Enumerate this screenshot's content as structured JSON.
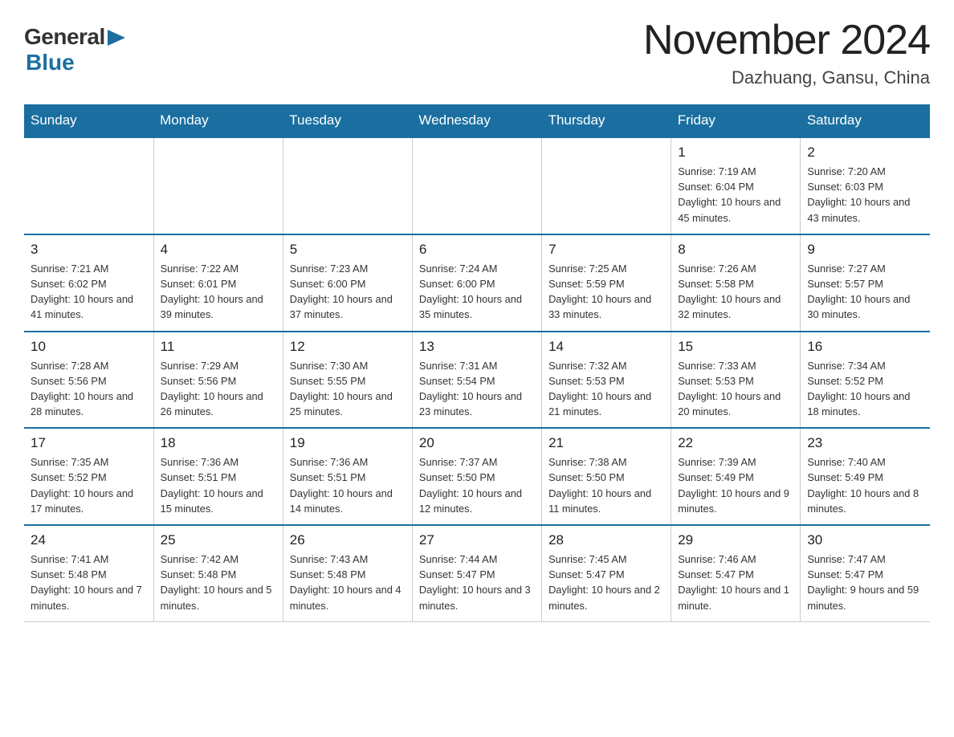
{
  "logo": {
    "general": "General",
    "blue": "Blue",
    "arrow": "▶"
  },
  "title": "November 2024",
  "subtitle": "Dazhuang, Gansu, China",
  "days_of_week": [
    "Sunday",
    "Monday",
    "Tuesday",
    "Wednesday",
    "Thursday",
    "Friday",
    "Saturday"
  ],
  "weeks": [
    [
      {
        "num": "",
        "info": ""
      },
      {
        "num": "",
        "info": ""
      },
      {
        "num": "",
        "info": ""
      },
      {
        "num": "",
        "info": ""
      },
      {
        "num": "",
        "info": ""
      },
      {
        "num": "1",
        "info": "Sunrise: 7:19 AM\nSunset: 6:04 PM\nDaylight: 10 hours and 45 minutes."
      },
      {
        "num": "2",
        "info": "Sunrise: 7:20 AM\nSunset: 6:03 PM\nDaylight: 10 hours and 43 minutes."
      }
    ],
    [
      {
        "num": "3",
        "info": "Sunrise: 7:21 AM\nSunset: 6:02 PM\nDaylight: 10 hours and 41 minutes."
      },
      {
        "num": "4",
        "info": "Sunrise: 7:22 AM\nSunset: 6:01 PM\nDaylight: 10 hours and 39 minutes."
      },
      {
        "num": "5",
        "info": "Sunrise: 7:23 AM\nSunset: 6:00 PM\nDaylight: 10 hours and 37 minutes."
      },
      {
        "num": "6",
        "info": "Sunrise: 7:24 AM\nSunset: 6:00 PM\nDaylight: 10 hours and 35 minutes."
      },
      {
        "num": "7",
        "info": "Sunrise: 7:25 AM\nSunset: 5:59 PM\nDaylight: 10 hours and 33 minutes."
      },
      {
        "num": "8",
        "info": "Sunrise: 7:26 AM\nSunset: 5:58 PM\nDaylight: 10 hours and 32 minutes."
      },
      {
        "num": "9",
        "info": "Sunrise: 7:27 AM\nSunset: 5:57 PM\nDaylight: 10 hours and 30 minutes."
      }
    ],
    [
      {
        "num": "10",
        "info": "Sunrise: 7:28 AM\nSunset: 5:56 PM\nDaylight: 10 hours and 28 minutes."
      },
      {
        "num": "11",
        "info": "Sunrise: 7:29 AM\nSunset: 5:56 PM\nDaylight: 10 hours and 26 minutes."
      },
      {
        "num": "12",
        "info": "Sunrise: 7:30 AM\nSunset: 5:55 PM\nDaylight: 10 hours and 25 minutes."
      },
      {
        "num": "13",
        "info": "Sunrise: 7:31 AM\nSunset: 5:54 PM\nDaylight: 10 hours and 23 minutes."
      },
      {
        "num": "14",
        "info": "Sunrise: 7:32 AM\nSunset: 5:53 PM\nDaylight: 10 hours and 21 minutes."
      },
      {
        "num": "15",
        "info": "Sunrise: 7:33 AM\nSunset: 5:53 PM\nDaylight: 10 hours and 20 minutes."
      },
      {
        "num": "16",
        "info": "Sunrise: 7:34 AM\nSunset: 5:52 PM\nDaylight: 10 hours and 18 minutes."
      }
    ],
    [
      {
        "num": "17",
        "info": "Sunrise: 7:35 AM\nSunset: 5:52 PM\nDaylight: 10 hours and 17 minutes."
      },
      {
        "num": "18",
        "info": "Sunrise: 7:36 AM\nSunset: 5:51 PM\nDaylight: 10 hours and 15 minutes."
      },
      {
        "num": "19",
        "info": "Sunrise: 7:36 AM\nSunset: 5:51 PM\nDaylight: 10 hours and 14 minutes."
      },
      {
        "num": "20",
        "info": "Sunrise: 7:37 AM\nSunset: 5:50 PM\nDaylight: 10 hours and 12 minutes."
      },
      {
        "num": "21",
        "info": "Sunrise: 7:38 AM\nSunset: 5:50 PM\nDaylight: 10 hours and 11 minutes."
      },
      {
        "num": "22",
        "info": "Sunrise: 7:39 AM\nSunset: 5:49 PM\nDaylight: 10 hours and 9 minutes."
      },
      {
        "num": "23",
        "info": "Sunrise: 7:40 AM\nSunset: 5:49 PM\nDaylight: 10 hours and 8 minutes."
      }
    ],
    [
      {
        "num": "24",
        "info": "Sunrise: 7:41 AM\nSunset: 5:48 PM\nDaylight: 10 hours and 7 minutes."
      },
      {
        "num": "25",
        "info": "Sunrise: 7:42 AM\nSunset: 5:48 PM\nDaylight: 10 hours and 5 minutes."
      },
      {
        "num": "26",
        "info": "Sunrise: 7:43 AM\nSunset: 5:48 PM\nDaylight: 10 hours and 4 minutes."
      },
      {
        "num": "27",
        "info": "Sunrise: 7:44 AM\nSunset: 5:47 PM\nDaylight: 10 hours and 3 minutes."
      },
      {
        "num": "28",
        "info": "Sunrise: 7:45 AM\nSunset: 5:47 PM\nDaylight: 10 hours and 2 minutes."
      },
      {
        "num": "29",
        "info": "Sunrise: 7:46 AM\nSunset: 5:47 PM\nDaylight: 10 hours and 1 minute."
      },
      {
        "num": "30",
        "info": "Sunrise: 7:47 AM\nSunset: 5:47 PM\nDaylight: 9 hours and 59 minutes."
      }
    ]
  ]
}
